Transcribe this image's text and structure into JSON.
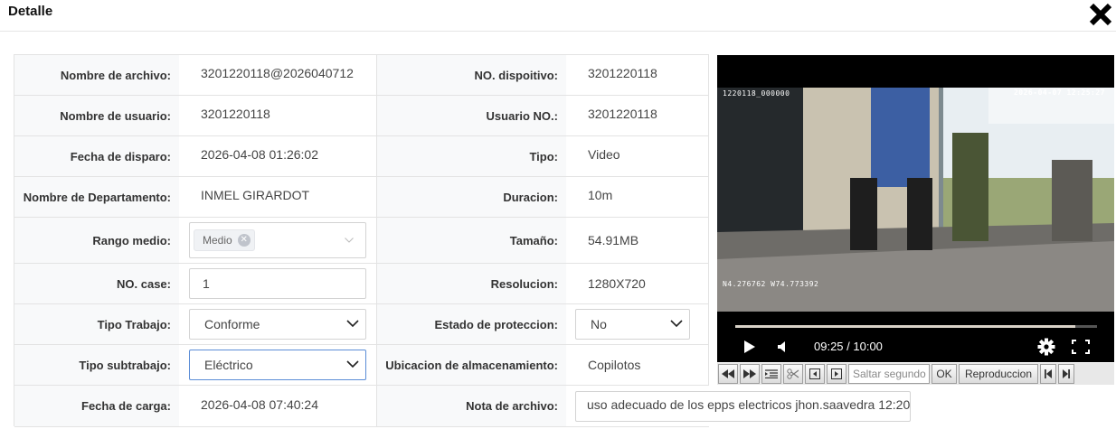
{
  "dialog": {
    "title": "Detalle"
  },
  "fields": {
    "nombre_archivo": {
      "label": "Nombre de archivo:",
      "value": "3201220118@2026040712"
    },
    "no_dispositivo": {
      "label": "NO. dispoitivo:",
      "value": "3201220118"
    },
    "nombre_usuario": {
      "label": "Nombre de usuario:",
      "value": "3201220118"
    },
    "usuario_no": {
      "label": "Usuario NO.:",
      "value": "3201220118"
    },
    "fecha_disparo": {
      "label": "Fecha de disparo:",
      "value": "2026-04-08 01:26:02"
    },
    "tipo": {
      "label": "Tipo:",
      "value": "Video"
    },
    "departamento": {
      "label": "Nombre de Departamento:",
      "value": "INMEL GIRARDOT"
    },
    "duracion": {
      "label": "Duracion:",
      "value": "10m"
    },
    "rango_medio": {
      "label": "Rango medio:",
      "tag": "Medio"
    },
    "tamano": {
      "label": "Tamaño:",
      "value": "54.91MB"
    },
    "no_case": {
      "label": "NO. case:",
      "value": "1"
    },
    "resolucion": {
      "label": "Resolucion:",
      "value": "1280X720"
    },
    "tipo_trabajo": {
      "label": "Tipo Trabajo:",
      "value": "Conforme"
    },
    "estado_proteccion": {
      "label": "Estado de proteccion:",
      "value": "No"
    },
    "tipo_subtrabajo": {
      "label": "Tipo subtrabajo:",
      "value": "Eléctrico"
    },
    "ubicacion": {
      "label": "Ubicacion de almacenamiento:",
      "value": "Copilotos"
    },
    "fecha_carga": {
      "label": "Fecha de carga:",
      "value": "2026-04-08 07:40:24"
    },
    "nota_archivo": {
      "label": "Nota de archivo:",
      "value": "uso adecuado de los epps electricos jhon.saavedra 12:20"
    }
  },
  "video": {
    "osd_id": "1220118_000000",
    "osd_datetime": "2026-04-07 12:25:27",
    "osd_coords": "N4.276762  W74.773392",
    "time_display": "09:25 / 10:00",
    "progress": 0.94
  },
  "toolbar": {
    "seek_placeholder": "Saltar segundo",
    "ok_label": "OK",
    "playback_label": "Reproduccion"
  },
  "icons": {
    "close": "close-icon",
    "play": "play-icon",
    "volume": "volume-icon",
    "settings": "gear-icon",
    "fullscreen": "fullscreen-icon"
  },
  "colors": {
    "focus_border": "#5b8dd6",
    "label_bg": "#f8f9fa",
    "video_bg": "#000000"
  }
}
